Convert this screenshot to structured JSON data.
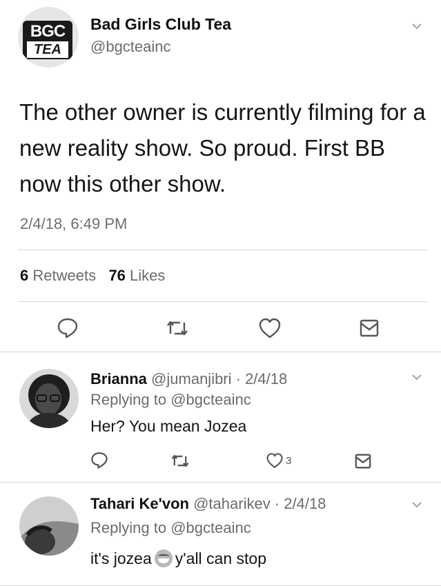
{
  "main_tweet": {
    "logo_top": "BGC",
    "logo_bottom": "TEA",
    "display_name": "Bad Girls Club Tea",
    "handle": "@bgcteainc",
    "text": "The other owner is currently filming for a new reality show. So proud. First BB now this other show.",
    "timestamp": "2/4/18, 6:49 PM",
    "retweets_count": "6",
    "retweets_label": "Retweets",
    "likes_count": "76",
    "likes_label": "Likes",
    "actions": [
      "reply-icon",
      "retweet-icon",
      "like-icon",
      "share-icon"
    ]
  },
  "replies": [
    {
      "name": "Brianna",
      "handle_date": "@jumanjibri · 2/4/18",
      "replying_prefix": "Replying to",
      "replying_handle": "@bgcteainc",
      "text": "Her? You mean Jozea",
      "like_count": "3"
    },
    {
      "name": "Tahari Ke'von",
      "handle_date": "@taharikev · 2/4/18",
      "replying_prefix": "Replying to",
      "replying_handle": "@bgcteainc",
      "text_before": "it's jozea",
      "emoji": "face-with-tears-of-joy",
      "text_after": "y'all can stop"
    }
  ]
}
